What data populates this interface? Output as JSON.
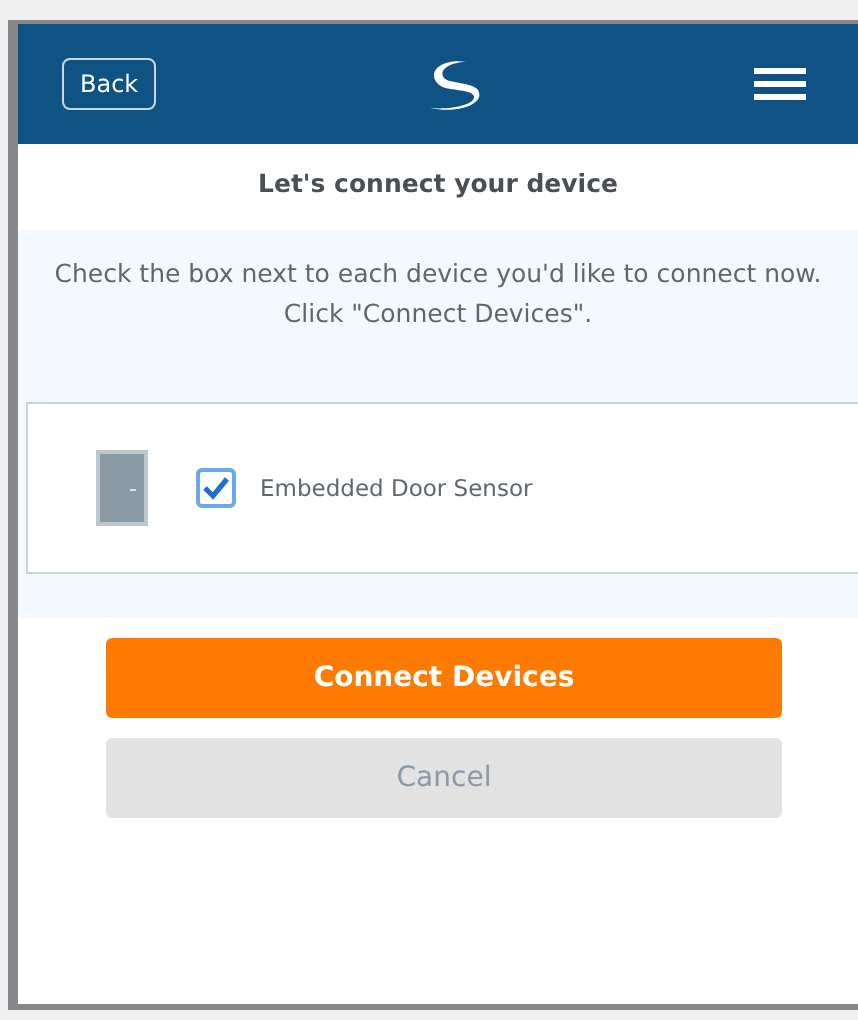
{
  "header": {
    "back_label": "Back"
  },
  "title": "Let's connect your device",
  "instructions": "Check the box next to each device you'd like to connect now. Click \"Connect Devices\".",
  "devices": [
    {
      "name": "Embedded Door Sensor",
      "kind": "door",
      "checked": true
    }
  ],
  "buttons": [
    {
      "label": "Connect Devices",
      "kind": "primary"
    },
    {
      "label": "Cancel",
      "kind": "secondary"
    }
  ]
}
